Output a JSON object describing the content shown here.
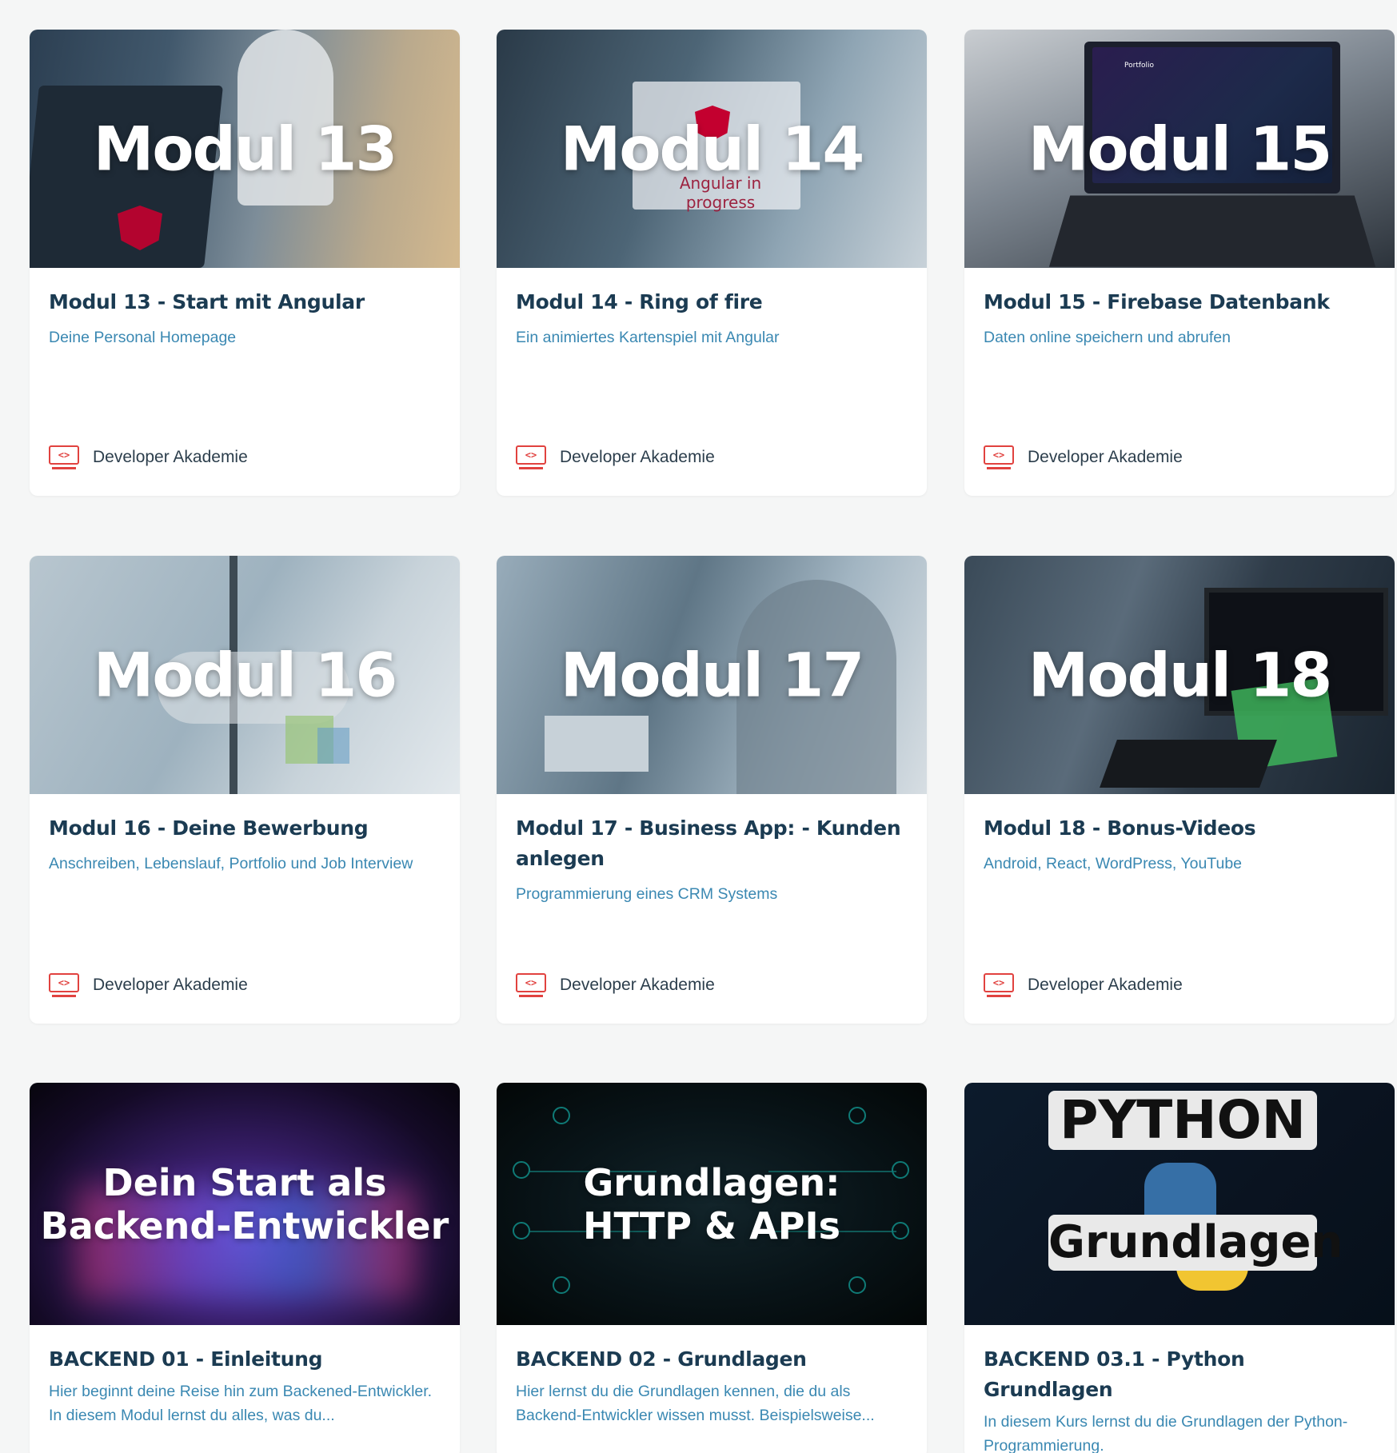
{
  "cards": [
    {
      "thumb_title": "Modul 13",
      "title": "Modul 13 - Start mit Angular",
      "subtitle": "Deine Personal Homepage",
      "brand": "Developer Akademie",
      "brand_icon": "code-monitor-icon"
    },
    {
      "thumb_title": "Modul 14",
      "thumb_sign": "Angular in progress",
      "title": "Modul 14 - Ring of fire",
      "subtitle": "Ein animiertes Kartenspiel mit Angular",
      "brand": "Developer Akademie",
      "brand_icon": "code-monitor-icon"
    },
    {
      "thumb_title": "Modul 15",
      "thumb_screen": "Portfolio",
      "title": "Modul 15 - Firebase Datenbank",
      "subtitle": "Daten online speichern und abrufen",
      "brand": "Developer Akademie",
      "brand_icon": "code-monitor-icon"
    },
    {
      "thumb_title": "Modul 16",
      "title": "Modul 16 - Deine Bewerbung",
      "subtitle": "Anschreiben, Lebenslauf, Portfolio und Job Interview",
      "brand": "Developer Akademie",
      "brand_icon": "code-monitor-icon"
    },
    {
      "thumb_title": "Modul 17",
      "title": "Modul 17 - Business App: - Kunden anlegen",
      "subtitle": "Programmierung eines CRM Systems",
      "brand": "Developer Akademie",
      "brand_icon": "code-monitor-icon"
    },
    {
      "thumb_title": "Modul 18",
      "title": "Modul 18 - Bonus-Videos",
      "subtitle": "Android, React, WordPress, YouTube",
      "brand": "Developer Akademie",
      "brand_icon": "code-monitor-icon"
    },
    {
      "thumb_title": "Dein Start als\nBackend-Entwickler",
      "title": "BACKEND 01 - Einleitung",
      "subtitle": "Hier beginnt deine Reise hin zum Backened-Entwickler. In diesem Modul lernst du alles, was du..."
    },
    {
      "thumb_title": "Grundlagen:\nHTTP & APIs",
      "title": "BACKEND 02 - Grundlagen",
      "subtitle": "Hier lernst du die Grundlagen kennen, die du als Backend-Entwickler wissen musst. Beispielsweise..."
    },
    {
      "thumb_label_top": "PYTHON",
      "thumb_label_bottom": "Grundlagen",
      "title": "BACKEND 03.1 - Python Grundlagen",
      "subtitle": "In diesem Kurs lernst du die Grundlagen der Python-Programmierung."
    }
  ],
  "colors": {
    "page_bg": "#f5f6f6",
    "card_bg": "#ffffff",
    "title": "#1b3b52",
    "subtitle": "#3a88b2",
    "brand_icon": "#e1423f"
  }
}
